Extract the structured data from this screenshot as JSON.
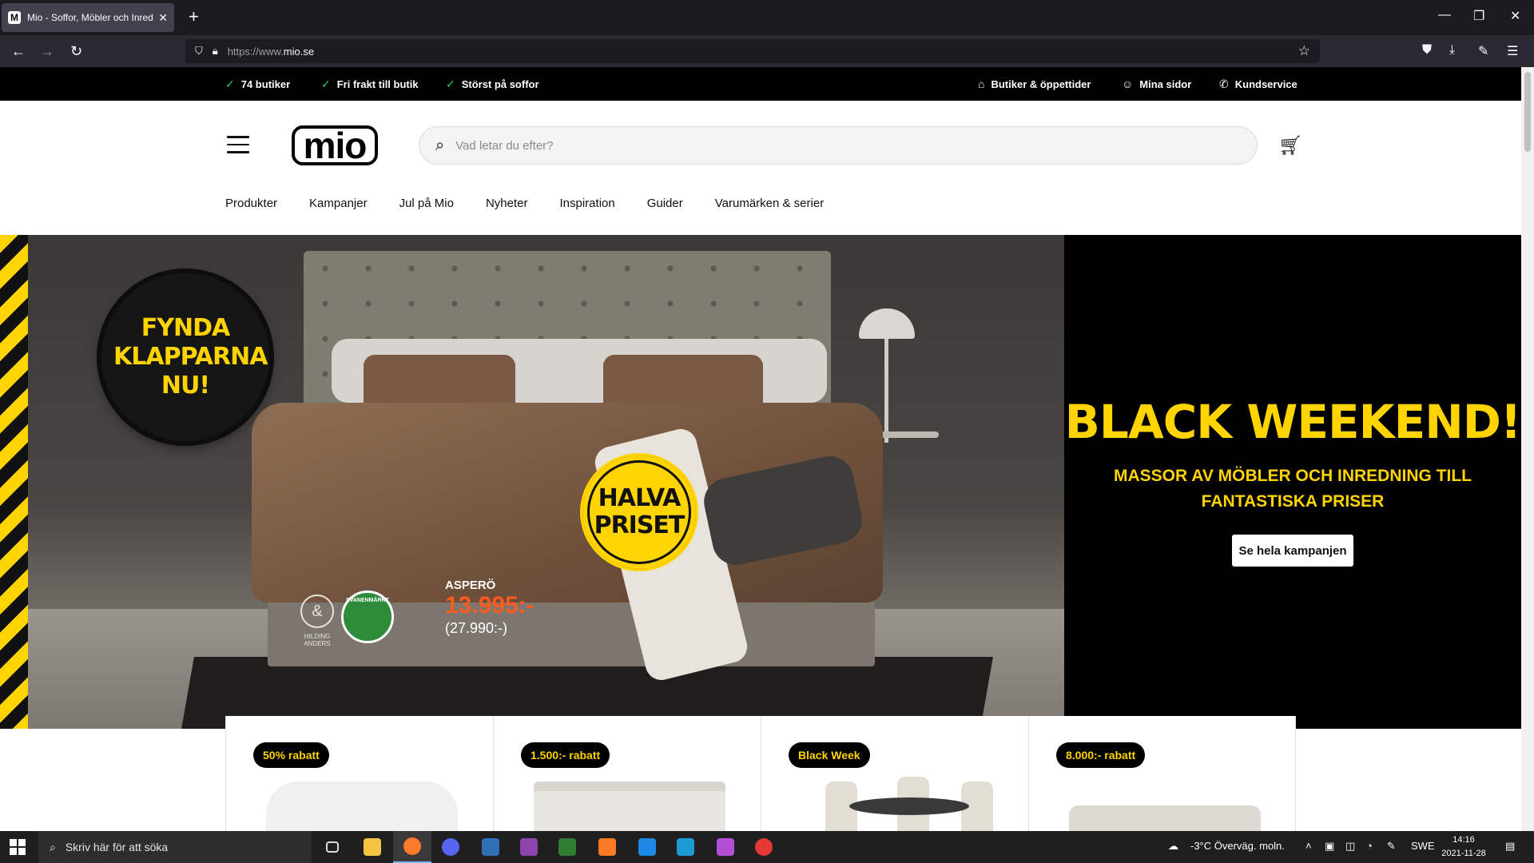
{
  "browser": {
    "tab_title": "Mio - Soffor, Möbler och Inredning",
    "tab_favicon_letter": "M",
    "url_proto": "https://www.",
    "url_host": "mio.se",
    "close_glyph": "✕",
    "newtab_glyph": "+"
  },
  "topstrip": {
    "usps": [
      "74 butiker",
      "Fri frakt till butik",
      "Störst på soffor"
    ],
    "links": [
      "Butiker & öppettider",
      "Mina sidor",
      "Kundservice"
    ]
  },
  "header": {
    "logo_text": "mio",
    "search_placeholder": "Vad letar du efter?"
  },
  "nav": [
    "Produkter",
    "Kampanjer",
    "Jul på Mio",
    "Nyheter",
    "Inspiration",
    "Guider",
    "Varumärken & serier"
  ],
  "hero": {
    "seal_text": "FYNDA KLAPPARNA NU!",
    "badge_text": "HALVA PRISET",
    "product_name": "ASPERÖ",
    "price": "13.995:-",
    "old_price": "(27.990:-)",
    "cert1_text": "HILDING ANDERS",
    "cert2_text": "SVANENMÄRKT",
    "title": "BLACK WEEKEND!",
    "subtitle": "MASSOR AV MÖBLER OCH INREDNING TILL FANTASTISKA PRISER",
    "cta": "Se hela kampanjen"
  },
  "cards": [
    {
      "badge": "50% rabatt"
    },
    {
      "badge": "1.500:- rabatt"
    },
    {
      "badge": "Black Week"
    },
    {
      "badge": "8.000:- rabatt"
    }
  ],
  "taskbar": {
    "search_placeholder": "Skriv här för att söka",
    "weather": "-3°C  Överväg. moln.",
    "lang": "SWE",
    "time": "14:16",
    "date": "2021-11-28"
  },
  "colors": {
    "brand_yellow": "#ffd400",
    "price_orange": "#ff5a1f",
    "check_green": "#2ecc71"
  },
  "icons": [
    "search-icon",
    "cart-icon",
    "store-icon",
    "user-icon",
    "phone-icon",
    "check-icon",
    "menu-icon"
  ]
}
